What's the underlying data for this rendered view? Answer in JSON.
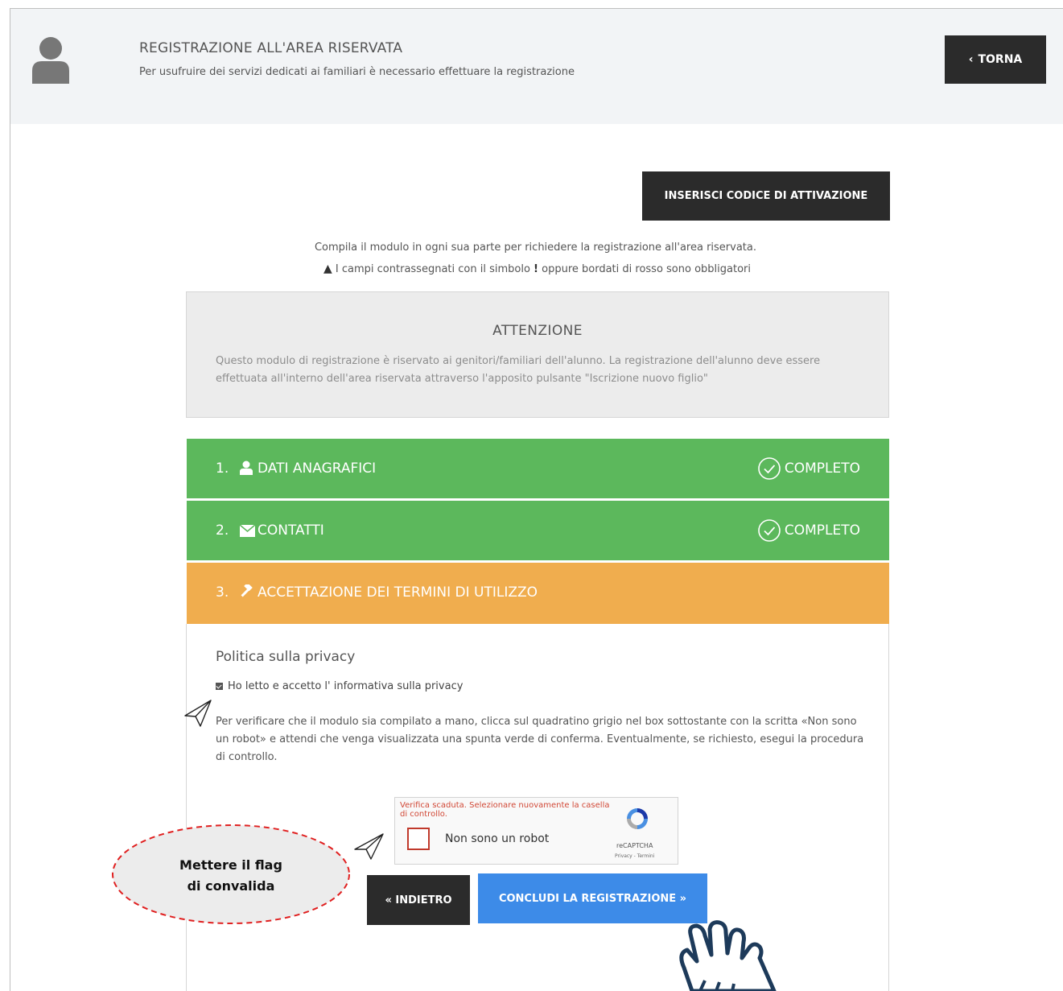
{
  "header": {
    "title": "REGISTRAZIONE ALL'AREA RISERVATA",
    "subtitle": "Per usufruire dei servizi dedicati ai familiari è necessario effettuare la registrazione",
    "back_button": "TORNA"
  },
  "activation_button": "INSERISCI CODICE DI ATTIVAZIONE",
  "intro": {
    "line1": "Compila il modulo in ogni sua parte per richiedere la registrazione all'area riservata.",
    "line2_pre": "I campi contrassegnati con il simbolo",
    "line2_symbol": "!",
    "line2_post": "oppure bordati di rosso sono obbligatori"
  },
  "attention": {
    "title": "ATTENZIONE",
    "text": "Questo modulo di registrazione è riservato ai genitori/familiari dell'alunno. La registrazione dell'alunno deve essere effettuata all'interno dell'area riservata attraverso l'apposito pulsante \"Iscrizione nuovo figlio\""
  },
  "steps": [
    {
      "number": "1.",
      "label": "DATI ANAGRAFICI",
      "status": "COMPLETO",
      "icon": "user-icon",
      "color": "#5cb85c"
    },
    {
      "number": "2.",
      "label": "CONTATTI",
      "status": "COMPLETO",
      "icon": "envelope-icon",
      "color": "#5cb85c"
    },
    {
      "number": "3.",
      "label": "ACCETTAZIONE DEI TERMINI DI UTILIZZO",
      "status": "",
      "icon": "gavel-icon",
      "color": "#f0ad4e"
    }
  ],
  "privacy": {
    "title": "Politica sulla privacy",
    "checkbox_label": "Ho letto e accetto l' informativa sulla privacy",
    "checked": true,
    "verify_text": "Per verificare che il modulo sia compilato a mano, clicca sul quadratino grigio nel box sottostante con la scritta «Non sono un robot» e attendi che venga visualizzata una spunta verde di conferma. Eventualmente, se richiesto, esegui la procedura di controllo."
  },
  "recaptcha": {
    "error": "Verifica scaduta. Selezionare nuovamente la casella di controllo.",
    "label": "Non sono un robot",
    "brand": "reCAPTCHA",
    "links": "Privacy - Termini"
  },
  "buttons": {
    "back": "« INDIETRO",
    "conclude": "CONCLUDI LA REGISTRAZIONE »"
  },
  "annotation": {
    "line1": "Mettere il flag",
    "line2": "di convalida"
  },
  "colors": {
    "dark_button": "#2b2b2b",
    "primary": "#3d8be8",
    "success": "#5cb85c",
    "warning": "#f0ad4e",
    "error": "#d14836",
    "annotation_border": "#e02020"
  }
}
